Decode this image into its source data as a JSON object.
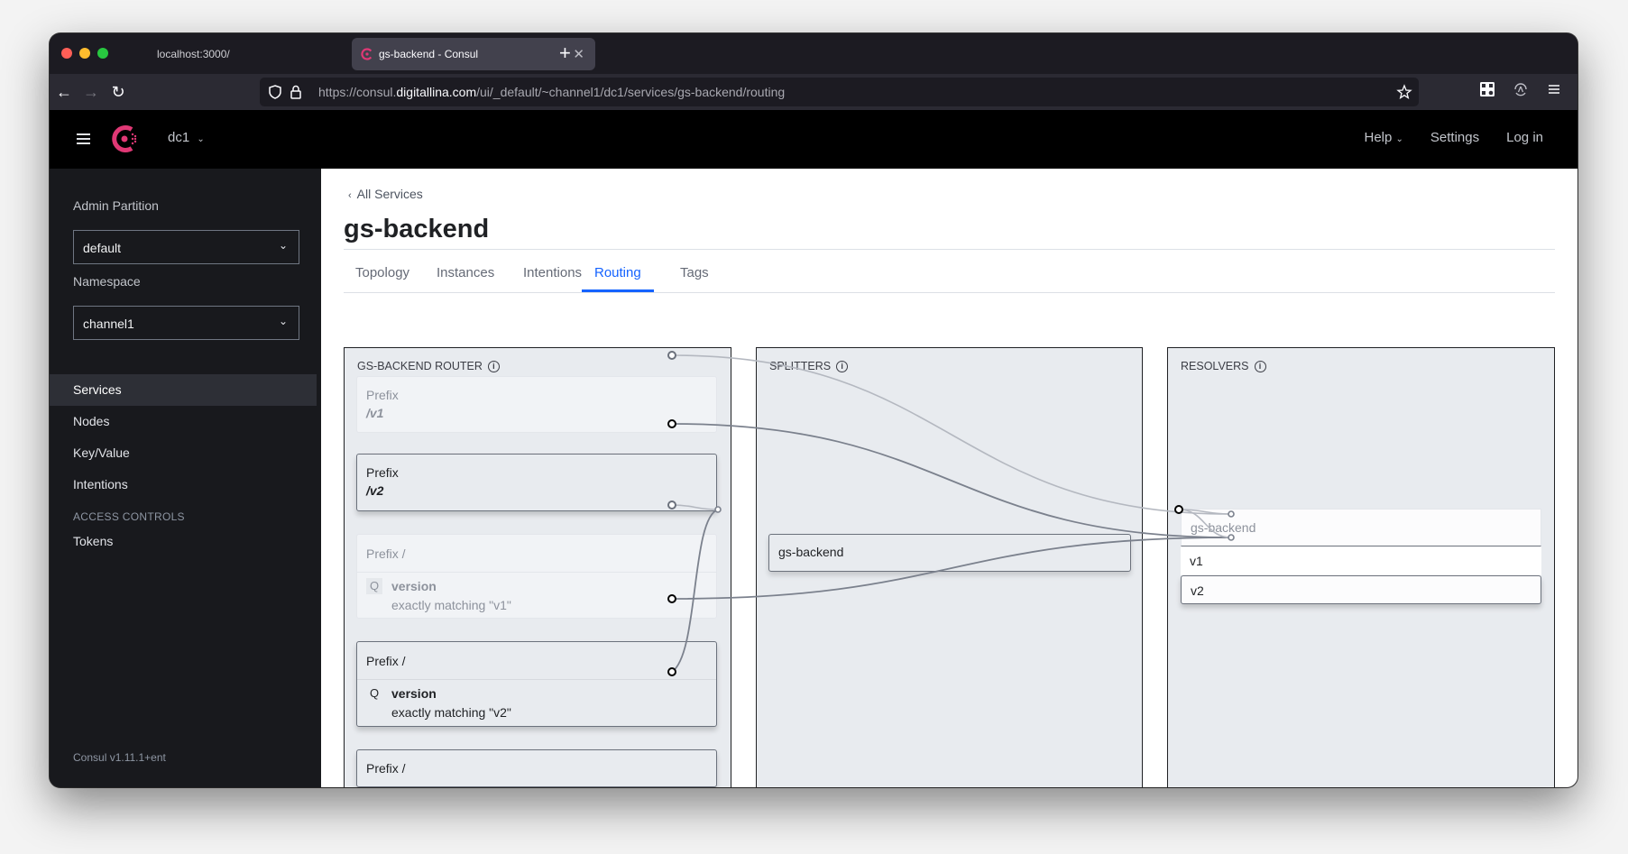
{
  "browser": {
    "tabs": [
      {
        "title": "localhost:3000/",
        "active": false
      },
      {
        "title": "gs-backend - Consul",
        "active": true
      }
    ],
    "url_prefix": "https://consul.",
    "url_host": "digitallina.com",
    "url_path": "/ui/_default/~channel1/dc1/services/gs-backend/routing",
    "icons": [
      "back-icon",
      "forward-icon",
      "reload-icon",
      "shield-icon",
      "lock-icon",
      "star-icon",
      "qr-code-icon",
      "sync-icon",
      "menu-icon"
    ]
  },
  "header": {
    "datacenter": "dc1",
    "help_label": "Help",
    "settings_label": "Settings",
    "login_label": "Log in",
    "brand_color": "#e03875"
  },
  "sidebar": {
    "partition_label": "Admin Partition",
    "partition_value": "default",
    "namespace_label": "Namespace",
    "namespace_value": "channel1",
    "items": [
      {
        "label": "Services",
        "active": true
      },
      {
        "label": "Nodes",
        "active": false
      },
      {
        "label": "Key/Value",
        "active": false
      },
      {
        "label": "Intentions",
        "active": false
      }
    ],
    "access_controls_heading": "ACCESS CONTROLS",
    "access_items": [
      {
        "label": "Tokens"
      }
    ],
    "version": "Consul v1.11.1+ent"
  },
  "main": {
    "breadcrumb": "All Services",
    "title": "gs-backend",
    "tabs": [
      {
        "label": "Topology",
        "active": false
      },
      {
        "label": "Instances",
        "active": false
      },
      {
        "label": "Intentions",
        "active": false
      },
      {
        "label": "Routing",
        "active": true
      },
      {
        "label": "Tags",
        "active": false
      }
    ],
    "accent_color": "#1563ff"
  },
  "routing": {
    "router": {
      "title": "GS-BACKEND ROUTER",
      "routes": [
        {
          "label": "Prefix",
          "value": "/v1",
          "highlighted": false
        },
        {
          "label": "Prefix",
          "value": "/v2",
          "highlighted": true
        },
        {
          "label": "Prefix /",
          "query_badge": "Q",
          "query_key": "version",
          "query_match": "exactly matching \"v1\"",
          "highlighted": false
        },
        {
          "label": "Prefix /",
          "query_badge": "Q",
          "query_key": "version",
          "query_match": "exactly matching \"v2\"",
          "highlighted": true
        },
        {
          "label": "Prefix /",
          "highlighted": true
        }
      ]
    },
    "splitters": {
      "title": "SPLITTERS",
      "nodes": [
        {
          "name": "gs-backend"
        }
      ]
    },
    "resolvers": {
      "title": "RESOLVERS",
      "resolver": {
        "name": "gs-backend",
        "subsets": [
          {
            "name": "v1",
            "highlighted": false
          },
          {
            "name": "v2",
            "highlighted": true
          }
        ]
      }
    },
    "connections": [
      {
        "from": "route-0",
        "to": "subset-v1",
        "highlighted": false
      },
      {
        "from": "route-1",
        "to": "subset-v2",
        "highlighted": true
      },
      {
        "from": "route-2",
        "to": "splitter-gs-backend",
        "highlighted": false
      },
      {
        "from": "route-3",
        "to": "subset-v2",
        "highlighted": true
      },
      {
        "from": "route-4",
        "to": "splitter-gs-backend",
        "highlighted": true
      },
      {
        "from": "splitter-gs-backend",
        "to": "subset-v1",
        "highlighted": false
      },
      {
        "from": "splitter-gs-backend",
        "to": "subset-v2",
        "highlighted": false
      }
    ]
  }
}
